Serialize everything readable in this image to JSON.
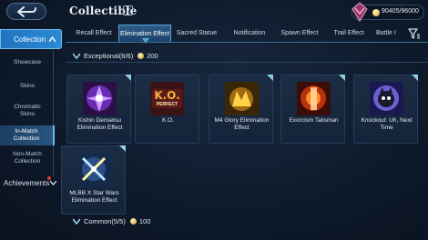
{
  "header": {
    "title": "Collectible",
    "info_icon": "?",
    "currency_value": "90405/96000"
  },
  "tabs": [
    {
      "label": "Recall Effect",
      "active": false
    },
    {
      "label": "Elimination Effect",
      "active": true
    },
    {
      "label": "Sacred Statue",
      "active": false
    },
    {
      "label": "Notification",
      "active": false
    },
    {
      "label": "Spawn Effect",
      "active": false
    },
    {
      "label": "Trail Effect",
      "active": false
    },
    {
      "label": "Battle I",
      "active": false
    }
  ],
  "sidebar": {
    "collection_label": "Collection",
    "items": [
      {
        "label": "Showcase"
      },
      {
        "label": "Skins"
      },
      {
        "label": "Chromatic Skins"
      },
      {
        "label": "In-Match Collection",
        "active": true
      },
      {
        "label": "Non-Match Collection"
      }
    ],
    "achievements_label": "Achievements"
  },
  "sections": [
    {
      "title": "Exceptional(6/6)",
      "points": "200"
    },
    {
      "title": "Common(5/5)",
      "points": "100"
    }
  ],
  "cards": [
    {
      "label": "Kishin Densetsu Elimination Effect",
      "thumb_text": ""
    },
    {
      "label": "K.O.",
      "thumb_text": "K.O.",
      "thumb_subtext": "PERFECT"
    },
    {
      "label": "M4 Glory Elimination Effect",
      "thumb_text": ""
    },
    {
      "label": "Exorcism Talisman",
      "thumb_text": ""
    },
    {
      "label": "Knockout: Uh, Next Time",
      "thumb_text": ""
    },
    {
      "label": "MLBB X Star Wars Elimination Effect",
      "thumb_text": ""
    }
  ],
  "colors": {
    "accent": "#2c89d4",
    "tab_active": "#2b5c89",
    "gold": "#d6a23a"
  }
}
